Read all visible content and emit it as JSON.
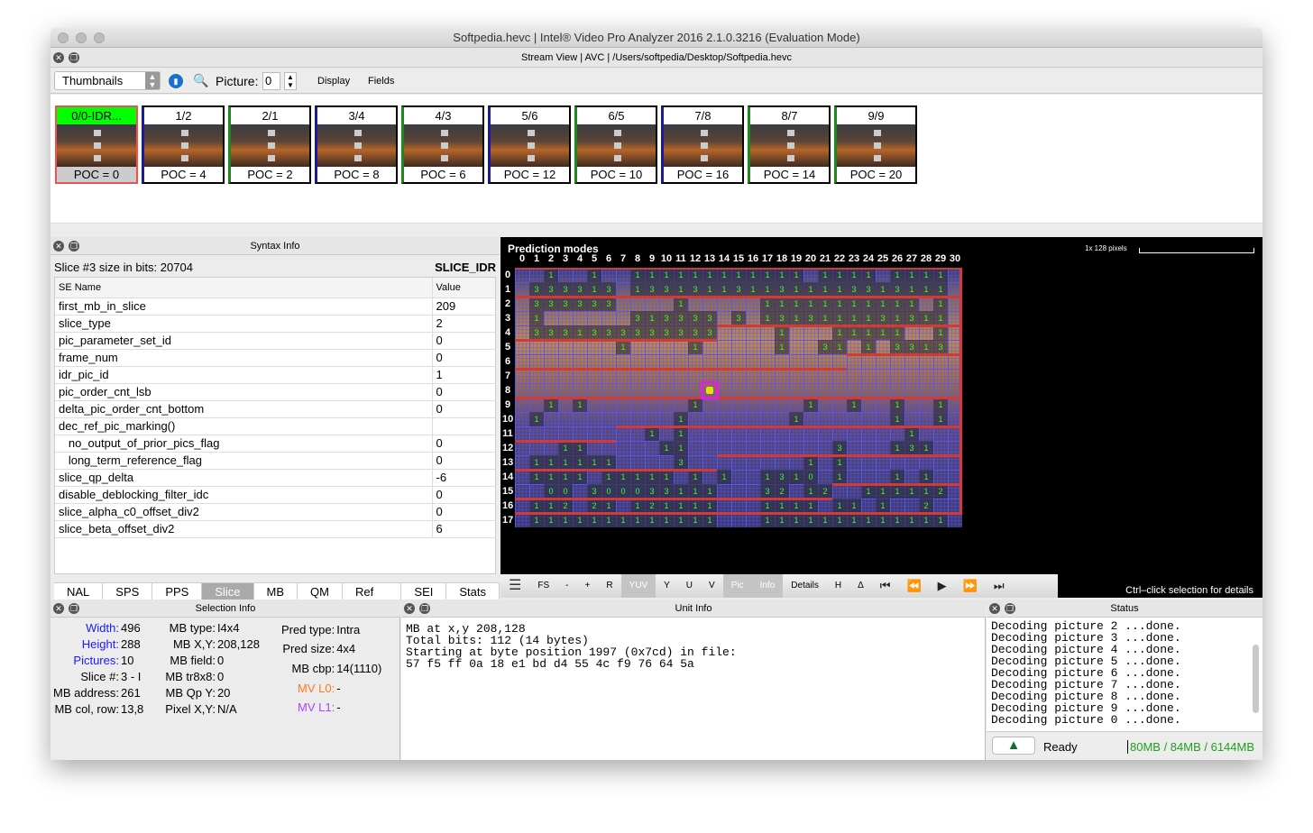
{
  "window": {
    "title": "Softpedia.hevc | Intel® Video Pro Analyzer 2016 2.1.0.3216  (Evaluation Mode)"
  },
  "stream": {
    "title": "Stream View | AVC | /Users/softpedia/Desktop/Softpedia.hevc"
  },
  "toolbar": {
    "view_mode": "Thumbnails",
    "picture_label": "Picture:",
    "picture_value": "0",
    "display": "Display",
    "fields": "Fields"
  },
  "thumbnails": [
    {
      "label": "0/0-IDR...",
      "poc": "POC = 0",
      "type": "idr"
    },
    {
      "label": "1/2",
      "poc": "POC = 4",
      "type": "b"
    },
    {
      "label": "2/1",
      "poc": "POC = 2",
      "type": "p"
    },
    {
      "label": "3/4",
      "poc": "POC = 8",
      "type": "b"
    },
    {
      "label": "4/3",
      "poc": "POC = 6",
      "type": "p"
    },
    {
      "label": "5/6",
      "poc": "POC = 12",
      "type": "b"
    },
    {
      "label": "6/5",
      "poc": "POC = 10",
      "type": "p"
    },
    {
      "label": "7/8",
      "poc": "POC = 16",
      "type": "b"
    },
    {
      "label": "8/7",
      "poc": "POC = 14",
      "type": "p"
    },
    {
      "label": "9/9",
      "poc": "POC = 20",
      "type": "p"
    }
  ],
  "syntax": {
    "title": "Syntax Info",
    "slice_size": "Slice #3 size in bits: 20704",
    "slice_type": "SLICE_IDR",
    "col_name": "SE Name",
    "col_value": "Value",
    "rows": [
      [
        "first_mb_in_slice",
        "209"
      ],
      [
        "slice_type",
        "2"
      ],
      [
        "pic_parameter_set_id",
        "0"
      ],
      [
        "frame_num",
        "0"
      ],
      [
        "idr_pic_id",
        "1"
      ],
      [
        "pic_order_cnt_lsb",
        "0"
      ],
      [
        "delta_pic_order_cnt_bottom",
        "0"
      ],
      [
        "dec_ref_pic_marking()",
        ""
      ],
      [
        "   no_output_of_prior_pics_flag",
        "0"
      ],
      [
        "   long_term_reference_flag",
        "0"
      ],
      [
        "slice_qp_delta",
        "-6"
      ],
      [
        "disable_deblocking_filter_idc",
        "0"
      ],
      [
        "slice_alpha_c0_offset_div2",
        "0"
      ],
      [
        "slice_beta_offset_div2",
        "6"
      ]
    ],
    "tabs": [
      "NAL",
      "SPS",
      "PPS",
      "Slice",
      "MB",
      "QM",
      "Ref Lists",
      "SEI",
      "Stats"
    ],
    "active_tab": "Slice"
  },
  "video": {
    "overlay_title": "Prediction modes",
    "scale": "1x  128 pixels",
    "hint": "Ctrl–click selection for details",
    "buttons": [
      "FS",
      "-",
      "+",
      "R",
      "YUV",
      "Y",
      "U",
      "V",
      "Pic",
      "Info",
      "Details",
      "H",
      "Δ"
    ],
    "active_buttons": [
      "YUV",
      "Pic",
      "Info"
    ],
    "transport": [
      "⏮",
      "⏪",
      "▶",
      "⏩",
      "⏭"
    ],
    "selected_mb": [
      13,
      8
    ],
    "modes": [
      "..1..1..111111111111.1111.1111.",
      ".333313.1331311311311113313111.",
      ".333333....1.....11111111111.1.",
      ".1......313333.3.1313111131311.",
      ".3331333333333....1...11111..1.",
      ".......1....1.....1..31.1.3313.",
      "...............................",
      "...............................",
      "...............................",
      "..1.1.......1.......1..1..1..1.",
      ".1.........1.......1......1..1.",
      ".........1.1...............1...",
      "...11.....11..........3...131..",
      ".111111....3........1.1........",
      ".1111.11111.1.1..1310.1...1.1..",
      "..00.300033111...32.12..111112.",
      ".112.21.121111...1111.11.1..2..",
      ".1111111111111...1111111111111."
    ]
  },
  "selection": {
    "title": "Selection Info",
    "col1": [
      [
        "Width:",
        "496"
      ],
      [
        "Height:",
        "288"
      ],
      [
        "Pictures:",
        "10"
      ],
      [
        "Slice #:",
        "3 - I"
      ],
      [
        "MB address:",
        "261"
      ],
      [
        "MB col, row:",
        "13,8"
      ]
    ],
    "col2": [
      [
        "MB type:",
        "I4x4"
      ],
      [
        "MB X,Y:",
        "208,128"
      ],
      [
        "MB field:",
        "0"
      ],
      [
        "MB tr8x8:",
        "0"
      ],
      [
        "MB Qp Y:",
        "20"
      ],
      [
        "Pixel X,Y:",
        "N/A"
      ]
    ],
    "col3": [
      [
        "Pred type:",
        "Intra"
      ],
      [
        "Pred size:",
        "4x4"
      ],
      [
        "MB cbp:",
        "14(1110)"
      ],
      [
        "",
        ""
      ],
      [
        "MV L0:",
        "-"
      ],
      [
        "MV L1:",
        "-"
      ]
    ]
  },
  "unit": {
    "title": "Unit Info",
    "text": "MB at x,y 208,128\nTotal bits: 112 (14 bytes)\nStarting at byte position 1997 (0x7cd) in file:\n57 f5 ff 0a 18 e1 bd d4 55 4c f9 76 64 5a"
  },
  "status": {
    "title": "Status",
    "log": "Decoding picture 2 ...done.\nDecoding picture 3 ...done.\nDecoding picture 4 ...done.\nDecoding picture 5 ...done.\nDecoding picture 6 ...done.\nDecoding picture 7 ...done.\nDecoding picture 8 ...done.\nDecoding picture 9 ...done.\nDecoding picture 0 ...done.",
    "state": "Ready",
    "memory": "80MB / 84MB / 6144MB"
  },
  "colors": {
    "idr": "#00ff00",
    "p_border": "#1a8a1a",
    "b_border": "#1a1a9a",
    "selected": "#f05050",
    "mode_digit": "#33ff33",
    "grid": "#5555ff",
    "slice_line": "#d03a3a",
    "label_blue": "#1a1aff",
    "mv_l0": "#ff7a1a",
    "mv_l1": "#b040ff",
    "memory": "#20a020"
  }
}
